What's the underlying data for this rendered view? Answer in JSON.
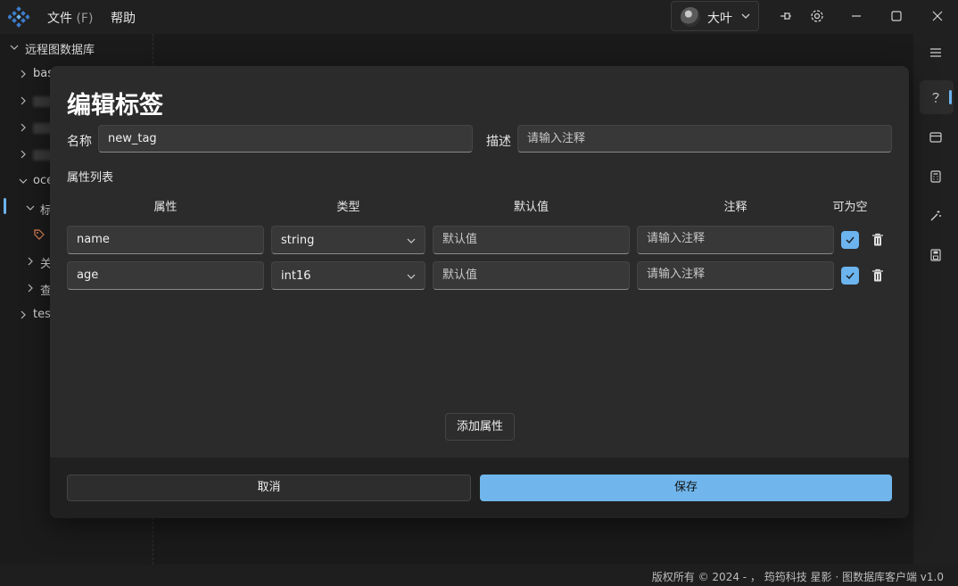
{
  "menu": {
    "file_label": "文件",
    "file_hotkey": "(F)",
    "help_label": "帮助"
  },
  "user": {
    "name": "大叶"
  },
  "sidebar": {
    "root_label": "远程图数据库",
    "items": [
      {
        "label": "bas"
      },
      {
        "label": ""
      },
      {
        "label": ""
      },
      {
        "label": ""
      },
      {
        "label": "oce"
      },
      {
        "label": "标"
      },
      {
        "label": ""
      },
      {
        "label": "关"
      },
      {
        "label": "查"
      },
      {
        "label": "test"
      }
    ]
  },
  "modal": {
    "title": "编辑标签",
    "name_label": "名称",
    "name_value": "new_tag",
    "desc_label": "描述",
    "desc_placeholder": "请输入注释",
    "props_title": "属性列表",
    "columns": {
      "attr": "属性",
      "type": "类型",
      "default": "默认值",
      "comment": "注释",
      "nullable": "可为空"
    },
    "rows": [
      {
        "name": "name",
        "type": "string",
        "default_placeholder": "默认值",
        "comment_placeholder": "请输入注释",
        "nullable": true
      },
      {
        "name": "age",
        "type": "int16",
        "default_placeholder": "默认值",
        "comment_placeholder": "请输入注释",
        "nullable": true
      }
    ],
    "add_button": "添加属性",
    "cancel_button": "取消",
    "save_button": "保存"
  },
  "footer": {
    "text": "版权所有 © 2024 - ， 筠筠科技  星影 · 图数据库客户端  v1.0"
  },
  "colors": {
    "accent": "#6cb4ee",
    "background": "#1c1c1c",
    "modal": "#2b2b2b"
  }
}
